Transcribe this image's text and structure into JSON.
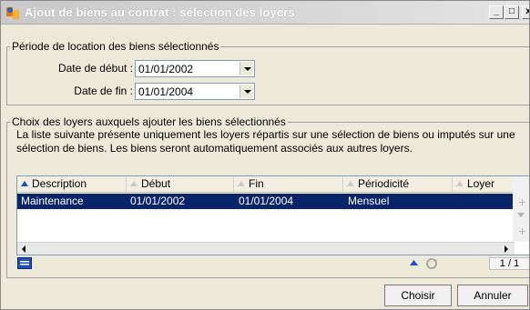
{
  "window": {
    "title": "Ajout de biens au contrat : sélection des loyers",
    "minimize_label": "_",
    "maximize_label": "□",
    "close_label": "x"
  },
  "period": {
    "group_title": "Période de location des biens sélectionnés",
    "start_label": "Date de début :",
    "start_value": "01/01/2002",
    "end_label": "Date de fin :",
    "end_value": "01/01/2004"
  },
  "rents": {
    "group_title": "Choix des loyers auxquels ajouter les biens sélectionnés",
    "description": "La liste suivante présente uniquement les loyers répartis sur une sélection de biens ou imputés sur une sélection de biens. Les biens seront automatiquement associés aux autres loyers.",
    "columns": [
      "Description",
      "Début",
      "Fin",
      "Périodicité",
      "Loyer"
    ],
    "rows": [
      {
        "description": "Maintenance",
        "debut": "01/01/2002",
        "fin": "01/01/2004",
        "periodicite": "Mensuel",
        "loyer": ""
      }
    ],
    "counter": "1 / 1"
  },
  "footer": {
    "choose_label": "Choisir",
    "cancel_label": "Annuler"
  },
  "colors": {
    "selection": "#0a246a",
    "sort_active": "#1a4ed0"
  }
}
